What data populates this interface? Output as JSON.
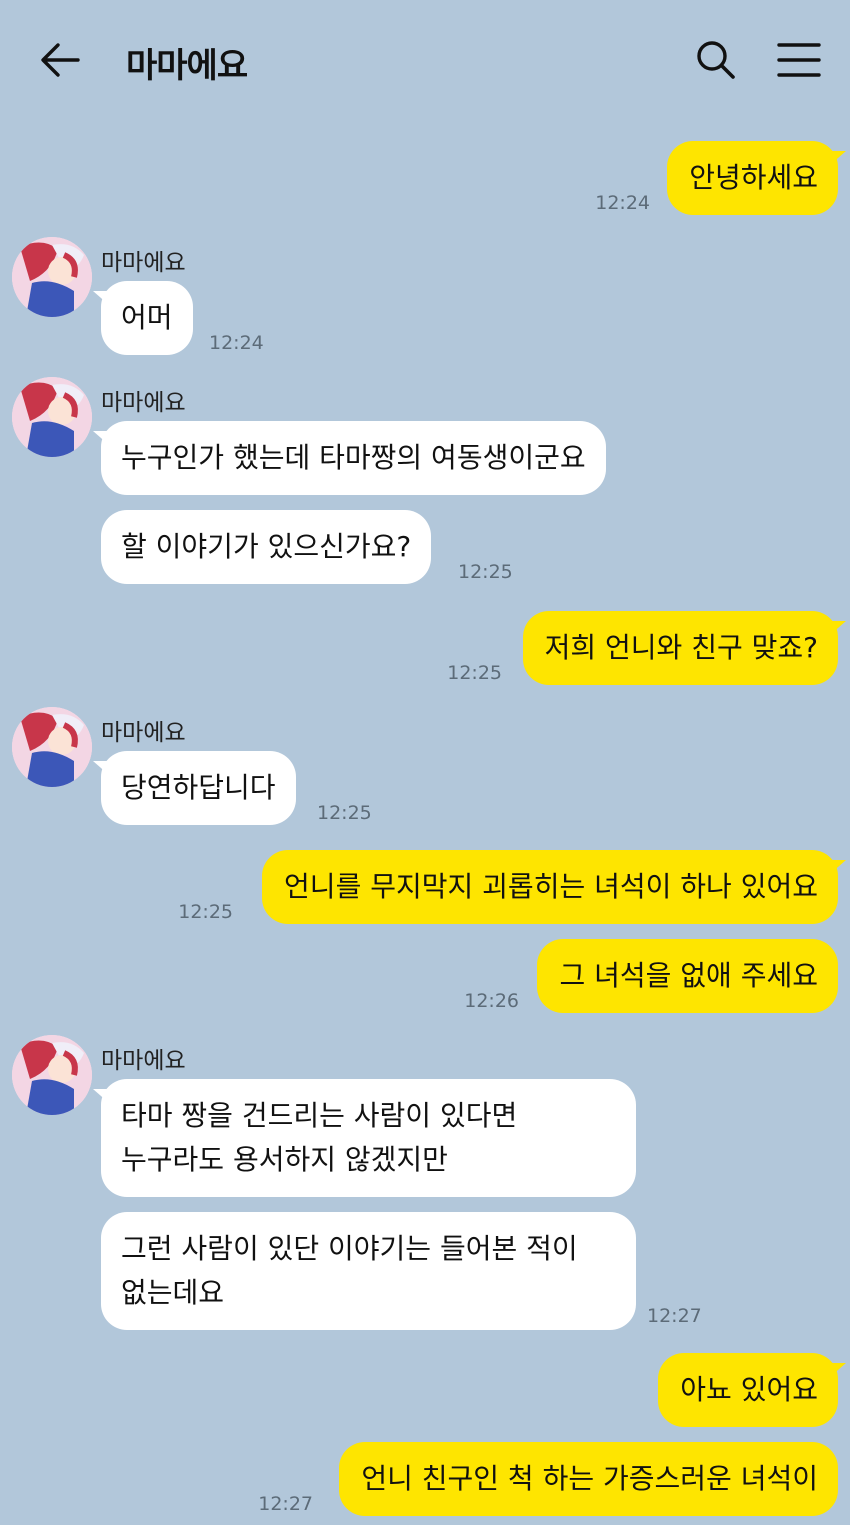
{
  "header": {
    "title": "마마에요",
    "back_icon": "arrow-left-icon",
    "search_icon": "search-icon",
    "menu_icon": "menu-icon"
  },
  "colors": {
    "background": "#b2c7da",
    "outgoing_bubble": "#fee500",
    "incoming_bubble": "#ffffff",
    "time_text": "#5c6b78"
  },
  "messages": [
    {
      "direction": "out",
      "text": "안녕하세요",
      "time": "12:24"
    },
    {
      "direction": "in",
      "sender": "마마에요",
      "text": "어머",
      "time": "12:24"
    },
    {
      "direction": "in",
      "sender": "마마에요",
      "text": "누구인가 했는데 타마짱의 여동생이군요"
    },
    {
      "direction": "in",
      "text": "할 이야기가 있으신가요?",
      "time": "12:25"
    },
    {
      "direction": "out",
      "text": "저희 언니와 친구 맞죠?",
      "time": "12:25"
    },
    {
      "direction": "in",
      "sender": "마마에요",
      "text": "당연하답니다",
      "time": "12:25"
    },
    {
      "direction": "out",
      "text": "언니를 무지막지 괴롭히는 녀석이 하나 있어요",
      "time": "12:25"
    },
    {
      "direction": "out",
      "text": "그 녀석을 없애 주세요",
      "time": "12:26"
    },
    {
      "direction": "in",
      "sender": "마마에요",
      "lines": [
        "타마 짱을 건드리는 사람이 있다면",
        "누구라도 용서하지 않겠지만"
      ]
    },
    {
      "direction": "in",
      "lines": [
        "그런 사람이 있단 이야기는 들어본 적이",
        "없는데요"
      ],
      "time": "12:27"
    },
    {
      "direction": "out",
      "text": "아뇨 있어요"
    },
    {
      "direction": "out",
      "text": "언니 친구인 척 하는 가증스러운 녀석이",
      "time": "12:27"
    }
  ]
}
